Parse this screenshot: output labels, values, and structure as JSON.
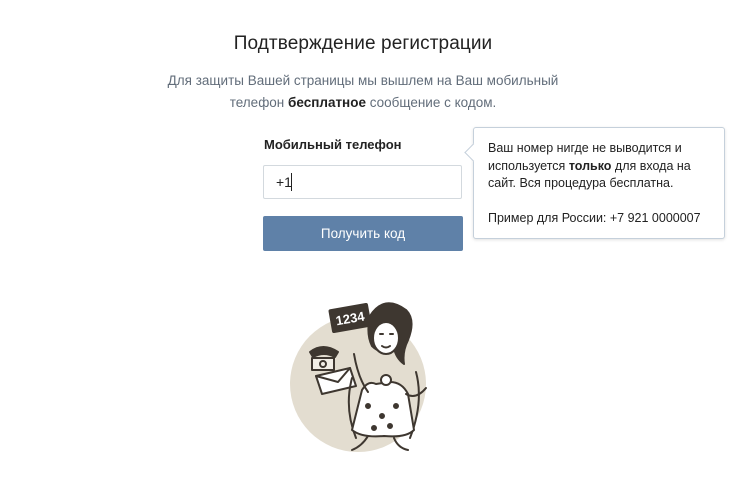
{
  "page": {
    "title": "Подтверждение регистрации",
    "description_part1": "Для защиты Вашей страницы мы вышлем на Ваш мобильный",
    "description_part2": "телефон ",
    "description_bold": "бесплатное",
    "description_part3": " сообщение с кодом."
  },
  "form": {
    "phone_label": "Мобильный телефон",
    "phone_value": "+1",
    "submit_label": "Получить код"
  },
  "tooltip": {
    "line1": "Ваш номер нигде не выводится и",
    "line2_pre": "используется ",
    "line2_bold": "только",
    "line2_post": " для входа на",
    "line3": "сайт. Вся процедура бесплатна.",
    "example": "Пример для России: +7 921 0000007"
  },
  "illustration": {
    "sign_text": "1234",
    "icon": "woman-holding-sms-code-illustration"
  },
  "colors": {
    "button": "#5f81a8",
    "illustration_bg": "#e3ddd0",
    "illustration_ink": "#3e3730"
  }
}
